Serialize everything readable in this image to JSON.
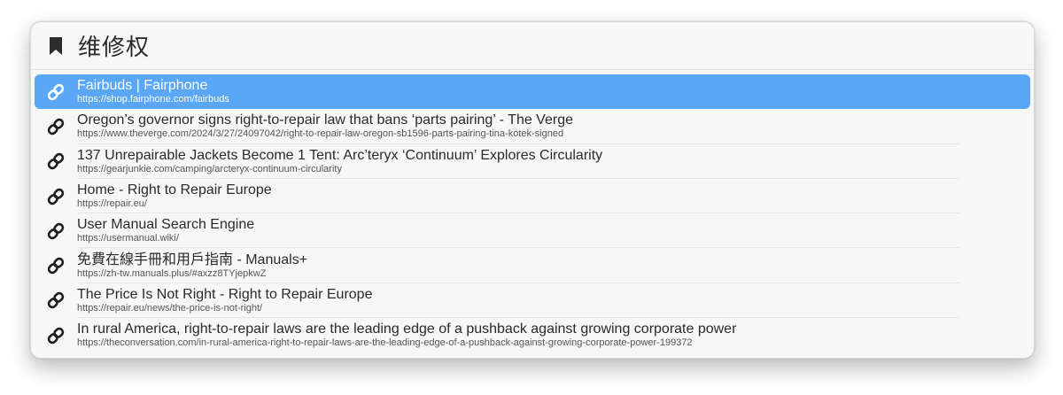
{
  "header": {
    "title": "维修权",
    "icon": "bookmark-icon"
  },
  "items": [
    {
      "title": "Fairbuds | Fairphone",
      "url": "https://shop.fairphone.com/fairbuds",
      "selected": true,
      "icon": "link-icon"
    },
    {
      "title": "Oregon’s governor signs right-to-repair law that bans ‘parts pairing’ - The Verge",
      "url": "https://www.theverge.com/2024/3/27/24097042/right-to-repair-law-oregon-sb1596-parts-pairing-tina-kotek-signed",
      "icon": "link-icon"
    },
    {
      "title": "137 Unrepairable Jackets Become 1 Tent: Arc’teryx ‘Continuum’ Explores Circularity",
      "url": "https://gearjunkie.com/camping/arcteryx-continuum-circularity",
      "icon": "link-icon"
    },
    {
      "title": "Home - Right to Repair Europe",
      "url": "https://repair.eu/",
      "icon": "link-icon"
    },
    {
      "title": "User Manual Search Engine",
      "url": "https://usermanual.wiki/",
      "icon": "link-icon"
    },
    {
      "title": "免費在線手冊和用戶指南 - Manuals+",
      "url": "https://zh-tw.manuals.plus/#axzz8TYjepkwZ",
      "icon": "link-icon"
    },
    {
      "title": "The Price Is Not Right - Right to Repair Europe",
      "url": "https://repair.eu/news/the-price-is-not-right/",
      "icon": "link-icon"
    },
    {
      "title": "In rural America, right-to-repair laws are the leading edge of a pushback against growing corporate power",
      "url": "https://theconversation.com/in-rural-america-right-to-repair-laws-are-the-leading-edge-of-a-pushback-against-growing-corporate-power-199372",
      "icon": "link-icon"
    }
  ],
  "colors": {
    "selected": "#5aa7f7",
    "panel": "#f7f7f7"
  }
}
